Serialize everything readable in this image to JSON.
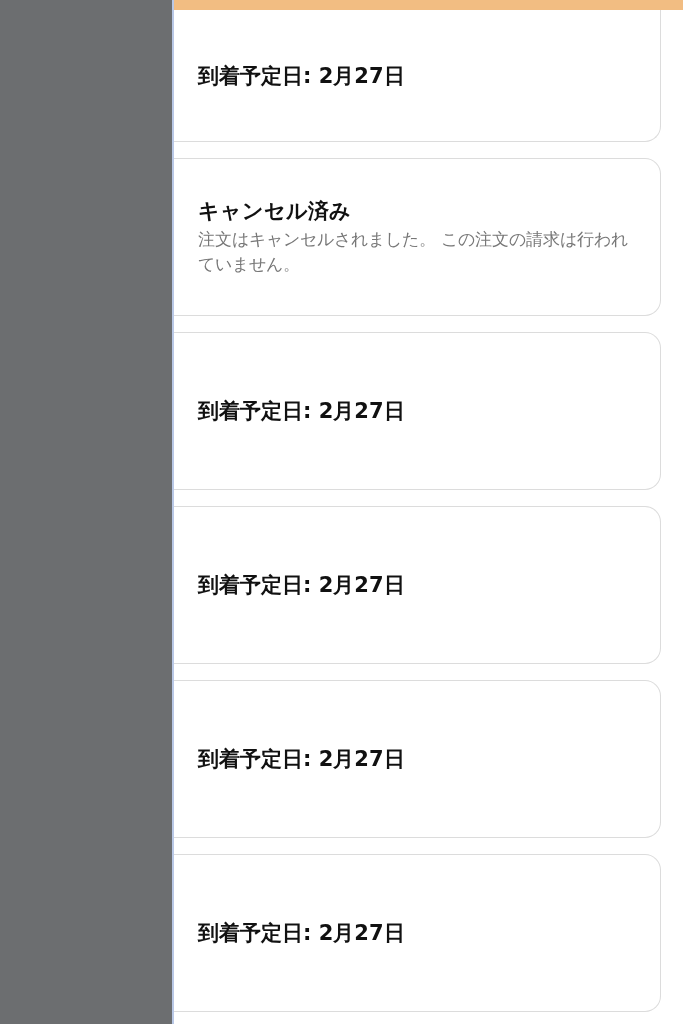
{
  "orders": [
    {
      "kind": "delivery",
      "text": "到着予定日: 2月27日"
    },
    {
      "kind": "cancelled",
      "title": "キャンセル済み",
      "message": "注文はキャンセルされました。 この注文の請求は行われていません。"
    },
    {
      "kind": "delivery",
      "text": "到着予定日: 2月27日"
    },
    {
      "kind": "delivery",
      "text": "到着予定日: 2月27日"
    },
    {
      "kind": "delivery",
      "text": "到着予定日: 2月27日"
    },
    {
      "kind": "delivery",
      "text": "到着予定日: 2月27日"
    }
  ]
}
